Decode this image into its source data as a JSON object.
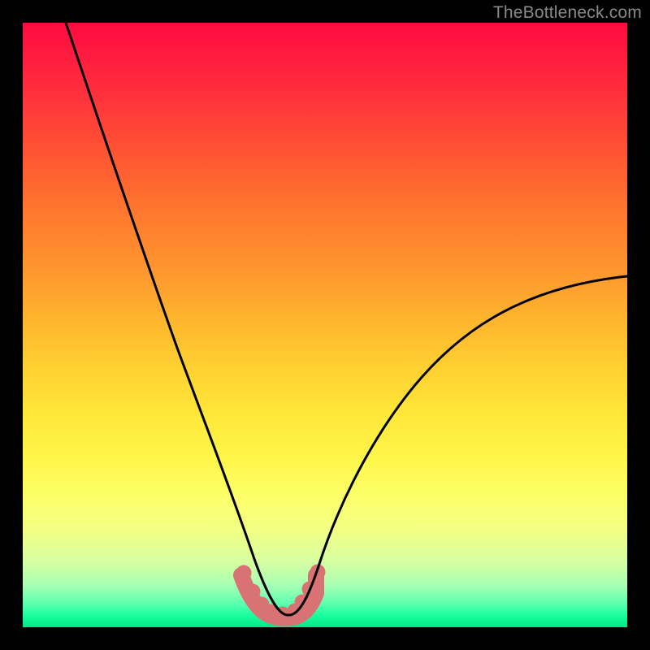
{
  "watermark": "TheBottleneck.com",
  "chart_data": {
    "type": "line",
    "title": "",
    "xlabel": "",
    "ylabel": "",
    "xlim": [
      0,
      100
    ],
    "ylim": [
      0,
      100
    ],
    "grid": false,
    "legend": false,
    "notes": "Two black curves on a vertical rainbow heat gradient; a small salmon U-shaped band with dots sits at the bottom between the curves. No axes, ticks, or labels are rendered.",
    "series": [
      {
        "name": "left-curve",
        "x": [
          0,
          2,
          5,
          8,
          11,
          14,
          17,
          20,
          23,
          25,
          27,
          29,
          31,
          33,
          35,
          37,
          38,
          39,
          40,
          41,
          42,
          43,
          44
        ],
        "y": [
          100,
          95,
          88,
          81,
          74,
          67,
          60,
          53,
          46,
          41,
          36,
          31,
          26,
          22,
          18,
          14,
          12,
          10,
          8,
          6,
          4.5,
          3,
          2
        ]
      },
      {
        "name": "right-curve",
        "x": [
          44,
          45,
          46,
          47,
          49,
          51,
          54,
          58,
          62,
          67,
          73,
          79,
          85,
          91,
          97,
          100
        ],
        "y": [
          2,
          3,
          5,
          7,
          10,
          14,
          19,
          25,
          31,
          37,
          43,
          48,
          52,
          55,
          57,
          58
        ]
      },
      {
        "name": "bottom-band-dots",
        "x": [
          36.5,
          38.0,
          39.5,
          41.0,
          43.0,
          45.0,
          46.3,
          47.5,
          48.8
        ],
        "y": [
          9.0,
          6.0,
          3.8,
          2.6,
          2.2,
          2.8,
          4.2,
          6.4,
          9.2
        ]
      }
    ]
  }
}
